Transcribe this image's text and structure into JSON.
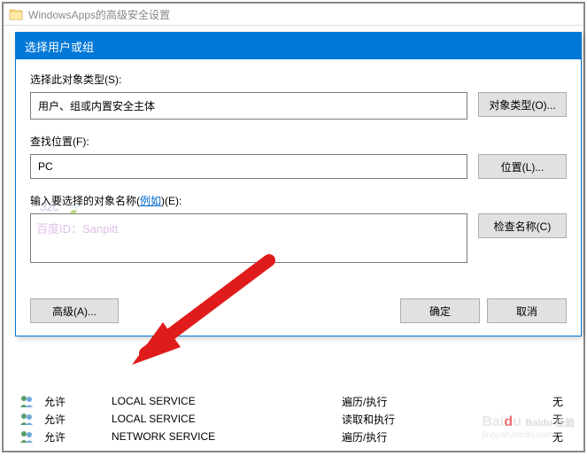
{
  "parent_window": {
    "title": "WindowsApps的高级安全设置"
  },
  "dialog": {
    "title": "选择用户或组",
    "object_type_label": "选择此对象类型(S):",
    "object_type_value": "用户、组或内置安全主体",
    "object_type_btn": "对象类型(O)...",
    "location_label": "查找位置(F):",
    "location_value": "PC",
    "location_btn": "位置(L)...",
    "names_label_part1": "输入要选择的对象名称(",
    "names_label_link": "例如",
    "names_label_part2": ")(E):",
    "names_value": "",
    "check_names_btn": "检查名称(C)",
    "advanced_btn": "高级(A)...",
    "ok_btn": "确定",
    "cancel_btn": "取消"
  },
  "watermark": {
    "text": "百度ID：Sanpitt"
  },
  "bg_table": {
    "rows": [
      {
        "access": "允许",
        "principal": "LOCAL SERVICE",
        "permission": "遍历/执行",
        "inherit": "无"
      },
      {
        "access": "允许",
        "principal": "LOCAL SERVICE",
        "permission": "读取和执行",
        "inherit": "无"
      },
      {
        "access": "允许",
        "principal": "NETWORK SERVICE",
        "permission": "遍历/执行",
        "inherit": "无"
      }
    ]
  },
  "baidu": {
    "logo": "Baidu 经验",
    "url": "jingyan.baidu.com"
  }
}
